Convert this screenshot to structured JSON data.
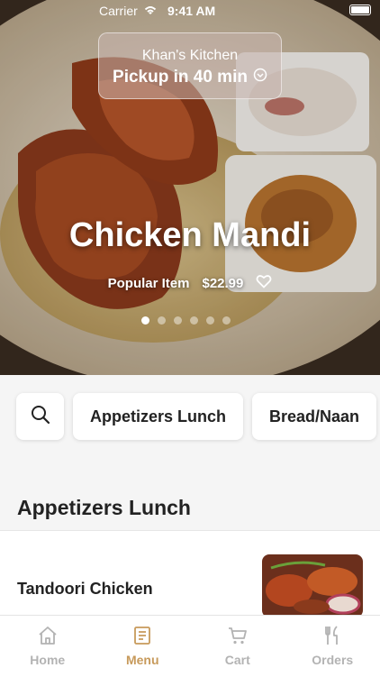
{
  "status_bar": {
    "carrier": "Carrier",
    "time": "9:41 AM"
  },
  "store": {
    "name": "Khan's Kitchen",
    "pickup": "Pickup in 40 min"
  },
  "hero": {
    "title": "Chicken Mandi",
    "tag": "Popular Item",
    "price": "$22.99",
    "slide_count": 6,
    "active_slide": 1
  },
  "categories": [
    {
      "label": "Appetizers Lunch"
    },
    {
      "label": "Bread/Naan"
    }
  ],
  "section": {
    "title": "Appetizers Lunch"
  },
  "items": [
    {
      "name": "Tandoori Chicken"
    }
  ],
  "tabs": [
    {
      "label": "Home",
      "icon": "home-icon"
    },
    {
      "label": "Menu",
      "icon": "menu-icon",
      "active": true
    },
    {
      "label": "Cart",
      "icon": "cart-icon"
    },
    {
      "label": "Orders",
      "icon": "fork-knife-icon"
    }
  ],
  "colors": {
    "accent": "#c79a5b",
    "inactive": "#b3b3b3"
  }
}
